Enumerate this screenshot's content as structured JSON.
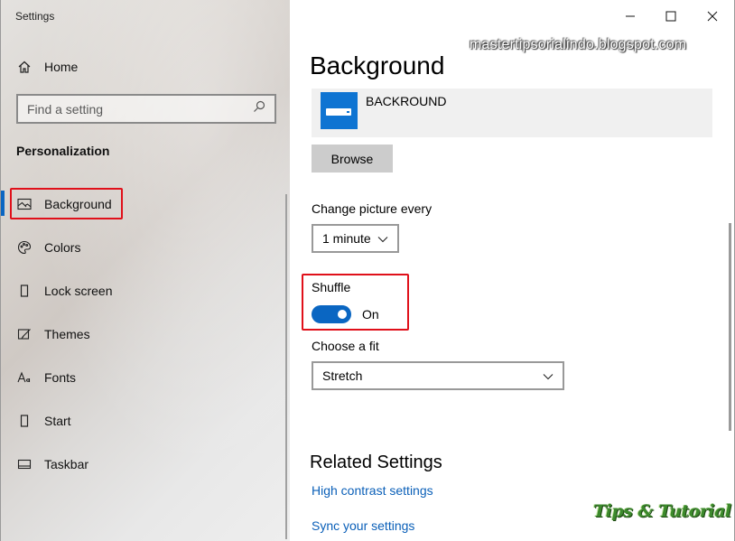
{
  "window": {
    "title": "Settings",
    "controls": {
      "minimize_icon": "minimize-icon",
      "maximize_icon": "maximize-icon",
      "close_icon": "close-icon"
    }
  },
  "sidebar": {
    "home_label": "Home",
    "search": {
      "placeholder": "Find a setting",
      "icon": "search-icon"
    },
    "section_title": "Personalization",
    "items": [
      {
        "label": "Background",
        "icon": "picture-icon",
        "selected": true
      },
      {
        "label": "Colors",
        "icon": "palette-icon",
        "selected": false
      },
      {
        "label": "Lock screen",
        "icon": "lock-screen-icon",
        "selected": false
      },
      {
        "label": "Themes",
        "icon": "themes-icon",
        "selected": false
      },
      {
        "label": "Fonts",
        "icon": "fonts-icon",
        "selected": false
      },
      {
        "label": "Start",
        "icon": "start-icon",
        "selected": false
      },
      {
        "label": "Taskbar",
        "icon": "taskbar-icon",
        "selected": false
      }
    ]
  },
  "main": {
    "watermark": "mastertipsorialindo.blogspot.com",
    "title": "Background",
    "preview": {
      "name": "BACKROUND"
    },
    "browse_label": "Browse",
    "change_picture": {
      "label": "Change picture every",
      "value": "1 minute"
    },
    "shuffle": {
      "label": "Shuffle",
      "state": "On",
      "enabled": true
    },
    "fit": {
      "label": "Choose a fit",
      "value": "Stretch"
    },
    "related": {
      "title": "Related Settings",
      "links": [
        "High contrast settings",
        "Sync your settings"
      ]
    },
    "logo_text": "Tips & Tutorial"
  },
  "colors": {
    "accent": "#0a66c2",
    "highlight_border": "#e0101a",
    "link": "#0a5fb8",
    "thumbnail": "#0e74d2"
  }
}
